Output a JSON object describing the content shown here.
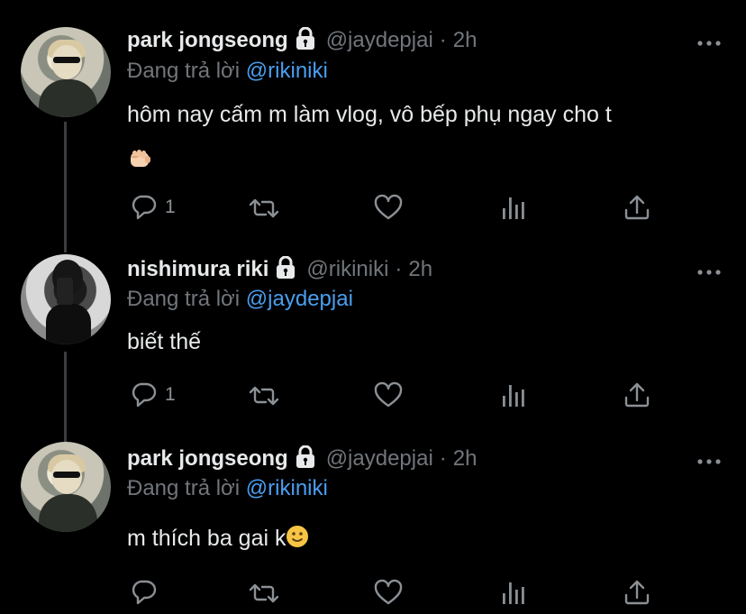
{
  "tweets": [
    {
      "name": "park jongseong",
      "handle": "@jaydepjai",
      "dot": "·",
      "time": "2h",
      "reply_prefix": "Đang trả lời",
      "reply_mention": "@rikiniki",
      "text_line1": "hôm nay cấm m làm vlog, vô bếp phụ ngay cho t",
      "text_emoji": "fist-emoji",
      "reply_count": "1"
    },
    {
      "name": "nishimura riki",
      "handle": "@rikiniki",
      "dot": "·",
      "time": "2h",
      "reply_prefix": "Đang trả lời",
      "reply_mention": "@jaydepjai",
      "text_line1": "biết thế",
      "reply_count": "1"
    },
    {
      "name": "park jongseong",
      "handle": "@jaydepjai",
      "dot": "·",
      "time": "2h",
      "reply_prefix": "Đang trả lời",
      "reply_mention": "@rikiniki",
      "text_line1": "m thích ba gai k",
      "text_emoji": "slightly-smiling-emoji",
      "reply_count": ""
    }
  ],
  "icons": {
    "lock": "lock-icon",
    "more": "more-icon",
    "reply": "reply-icon",
    "retweet": "retweet-icon",
    "like": "heart-icon",
    "views": "analytics-icon",
    "share": "share-icon"
  },
  "colors": {
    "background": "#000000",
    "text": "#e7e9ea",
    "secondary": "#71767b",
    "mention": "#4a9ef0",
    "thread_line": "#3a3d40"
  }
}
